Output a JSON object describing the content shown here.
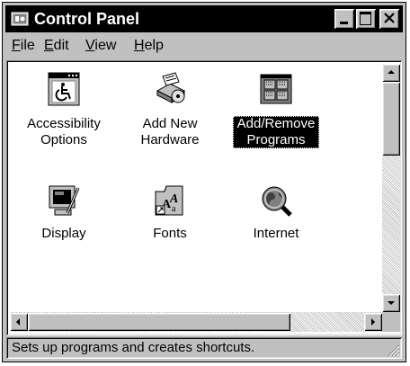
{
  "window": {
    "title": "Control Panel",
    "title_icon": "control-panel-icon"
  },
  "title_buttons": [
    "minimize-icon",
    "maximize-icon",
    "close-icon"
  ],
  "menu": [
    {
      "label": "File",
      "key": "F",
      "rest": "ile"
    },
    {
      "label": "Edit",
      "key": "E",
      "rest": "dit"
    },
    {
      "label": "View",
      "key": "V",
      "rest": "iew"
    },
    {
      "label": "Help",
      "key": "H",
      "rest": "elp"
    }
  ],
  "items": [
    {
      "line1": "Accessibility",
      "line2": "Options",
      "icon": "accessibility-icon",
      "selected": false
    },
    {
      "line1": "Add New",
      "line2": "Hardware",
      "icon": "hardware-icon",
      "selected": false
    },
    {
      "line1": "Add/Remove",
      "line2": "Programs",
      "icon": "programs-icon",
      "selected": true
    },
    {
      "line1": "Display",
      "line2": "",
      "icon": "display-icon",
      "selected": false
    },
    {
      "line1": "Fonts",
      "line2": "",
      "icon": "fonts-folder-icon",
      "selected": false
    },
    {
      "line1": "Internet",
      "line2": "",
      "icon": "internet-icon",
      "selected": false
    }
  ],
  "status": {
    "text": "Sets up programs and creates shortcuts."
  },
  "colors": {
    "titlebar": "#000000",
    "face": "#c0c0c0",
    "selection": "#000000"
  }
}
